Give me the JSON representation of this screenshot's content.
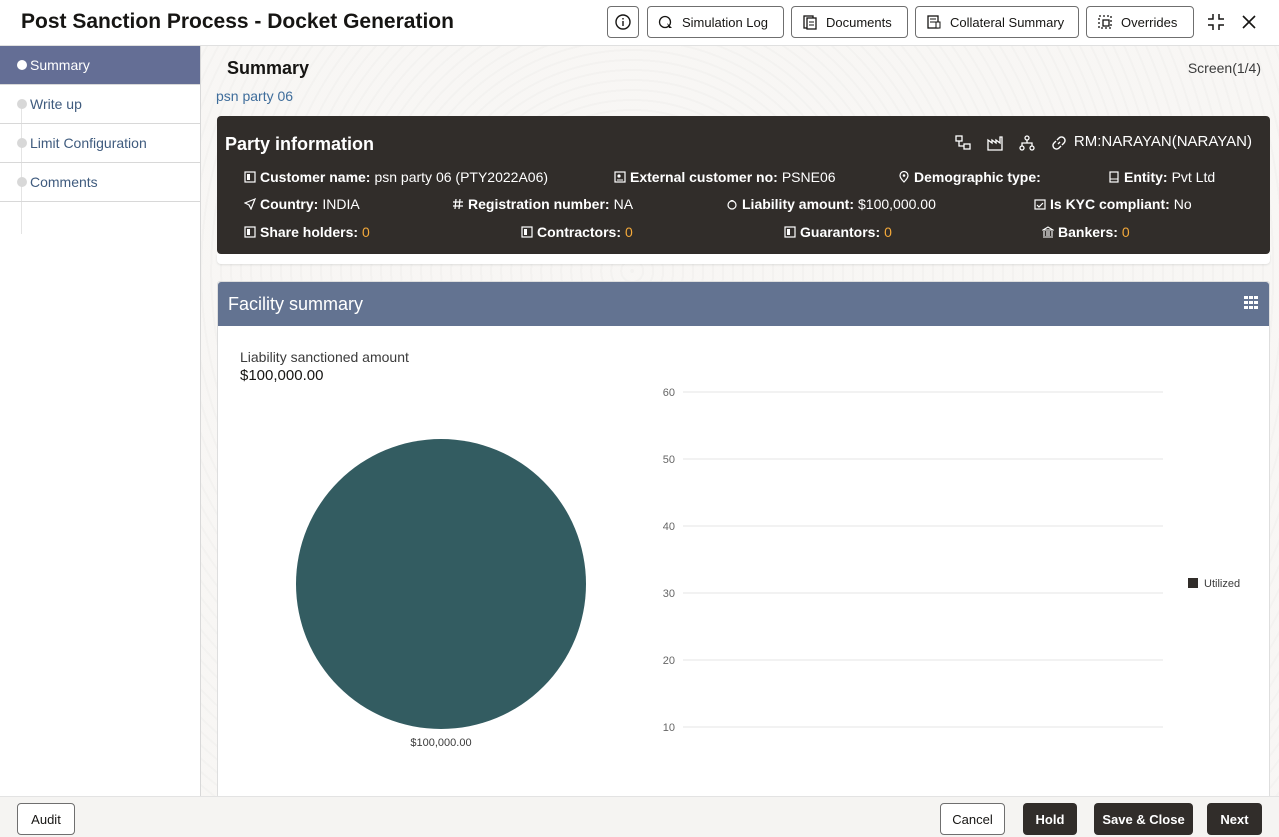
{
  "header": {
    "title": "Post Sanction Process - Docket Generation",
    "buttons": {
      "simulation_log": "Simulation Log",
      "documents": "Documents",
      "collateral_summary": "Collateral Summary",
      "overrides": "Overrides"
    }
  },
  "sidebar": {
    "items": [
      {
        "label": "Summary",
        "active": true
      },
      {
        "label": "Write up",
        "active": false
      },
      {
        "label": "Limit Configuration",
        "active": false
      },
      {
        "label": "Comments",
        "active": false
      }
    ]
  },
  "main": {
    "title": "Summary",
    "screen": "Screen(1/4)",
    "party_link": "psn party 06"
  },
  "party": {
    "title": "Party information",
    "rm": "RM:NARAYAN(NARAYAN)",
    "customer_name_label": "Customer name:",
    "customer_name": "psn party 06 (PTY2022A06)",
    "external_no_label": "External customer no:",
    "external_no": "PSNE06",
    "demographic_label": "Demographic type:",
    "demographic": "",
    "entity_label": "Entity:",
    "entity": "Pvt Ltd",
    "country_label": "Country:",
    "country": "INDIA",
    "registration_label": "Registration number:",
    "registration": "NA",
    "liability_label": "Liability amount:",
    "liability": "$100,000.00",
    "kyc_label": "Is KYC compliant:",
    "kyc": "No",
    "shareholders_label": "Share holders:",
    "shareholders": "0",
    "contractors_label": "Contractors:",
    "contractors": "0",
    "guarantors_label": "Guarantors:",
    "guarantors": "0",
    "bankers_label": "Bankers:",
    "bankers": "0"
  },
  "facility": {
    "title": "Facility summary",
    "liability_label": "Liability sanctioned amount",
    "liability_value": "$100,000.00"
  },
  "chart_data": [
    {
      "type": "pie",
      "slices": [
        {
          "label": "$100,000.00",
          "value": 100000
        }
      ],
      "colors": [
        "#335c61"
      ]
    },
    {
      "type": "bar",
      "categories": [],
      "series": [
        {
          "name": "Utilized",
          "values": []
        }
      ],
      "y_ticks": [
        10,
        20,
        30,
        40,
        50,
        60
      ],
      "ylim": [
        0,
        60
      ],
      "legend": "right",
      "legend_color": "#312d2a"
    }
  ],
  "footer": {
    "audit": "Audit",
    "cancel": "Cancel",
    "hold": "Hold",
    "save_close": "Save & Close",
    "next": "Next"
  }
}
